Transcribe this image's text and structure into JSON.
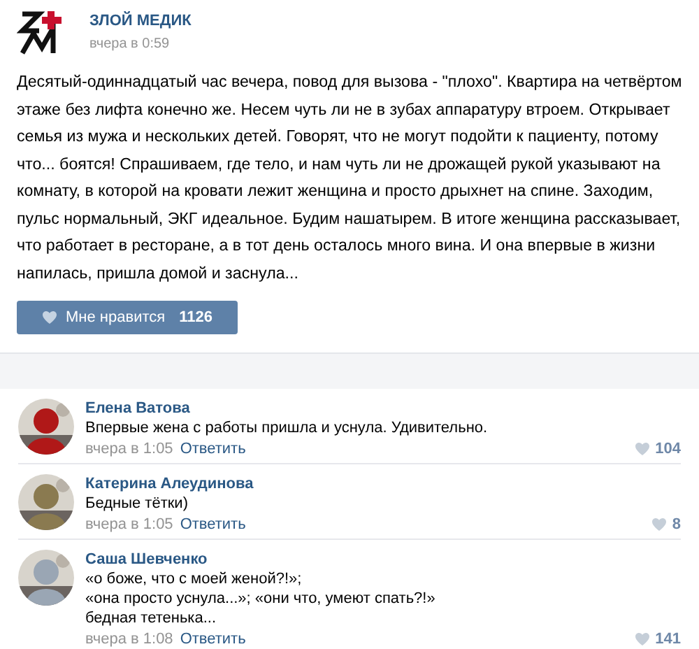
{
  "post": {
    "author": "ЗЛОЙ МЕДИК",
    "time": "вчера в 0:59",
    "text": "Десятый-одиннадцатый час вечера, повод для вызова - \"плохо\". Квартира на четвёртом этаже без лифта конечно же. Несем чуть ли не в зубах аппаратуру втроем. Открывает семья из мужа и нескольких детей. Говорят, что не могут подойти к пациенту, потому что... боятся! Спрашиваем, где тело, и нам чуть ли не дрожащей рукой указывают на комнату, в которой на кровати лежит женщина и просто дрыхнет на спине. Заходим, пульс нормальный, ЭКГ идеальное. Будим нашатырем. В итоге женщина рассказывает, что работает в ресторане, а в тот день осталось много вина. И она впервые в жизни напилась, пришла домой и заснула...",
    "like_label": "Мне нравится",
    "like_count": "1126"
  },
  "comments": [
    {
      "author": "Елена Ватова",
      "lines": [
        "Впервые жена с работы пришла и уснула. Удивительно."
      ],
      "time": "вчера в 1:05",
      "reply": "Ответить",
      "likes": "104"
    },
    {
      "author": "Катерина Алеудинова",
      "lines": [
        "Бедные тётки)"
      ],
      "time": "вчера в 1:05",
      "reply": "Ответить",
      "likes": "8"
    },
    {
      "author": "Саша Шевченко",
      "lines": [
        "«о боже, что с моей женой?!»;",
        "«она просто уснула...»; «они что, умеют спать?!»",
        "бедная тетенька..."
      ],
      "time": "вчера в 1:08",
      "reply": "Ответить",
      "likes": "141"
    }
  ]
}
